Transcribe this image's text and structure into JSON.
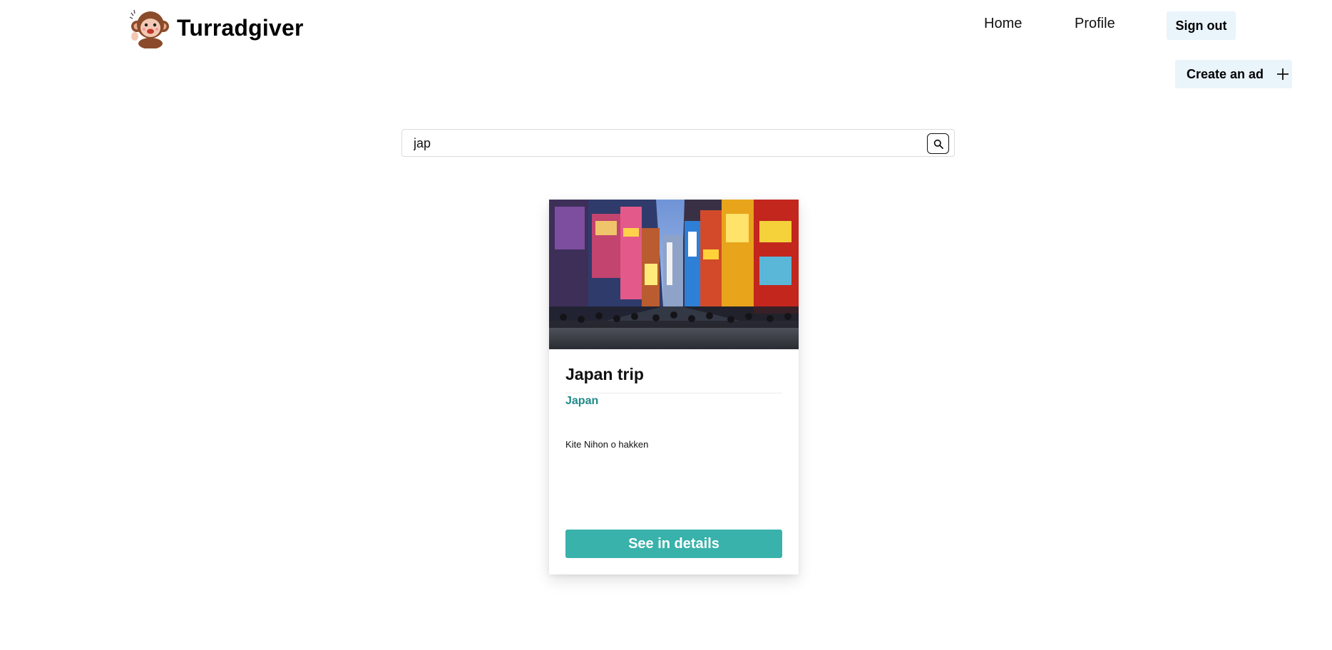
{
  "header": {
    "brand_title": "Turradgiver",
    "nav": {
      "home_label": "Home",
      "profile_label": "Profile",
      "signout_label": "Sign out"
    }
  },
  "actions": {
    "create_ad_label": "Create an ad",
    "create_ad_icon": "plus-icon"
  },
  "search": {
    "value": "jap",
    "icon": "search-icon"
  },
  "results": [
    {
      "title": "Japan trip",
      "location": "Japan",
      "description": "Kite Nihon o hakken",
      "button_label": "See in details"
    }
  ],
  "colors": {
    "accent": "#38b2aa",
    "location_text": "#1e8a88",
    "light_button_bg": "#eaf4fb"
  }
}
